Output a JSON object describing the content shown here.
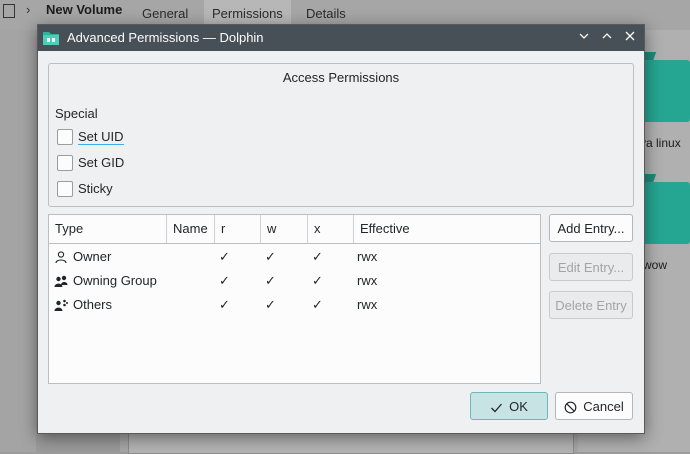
{
  "background": {
    "window_title": "New Volume",
    "tabs": [
      {
        "label": "General"
      },
      {
        "label": "Permissions"
      },
      {
        "label": "Details"
      }
    ],
    "folder_labels": [
      "va linux",
      "wow"
    ]
  },
  "dialog": {
    "title": "Advanced Permissions — Dolphin",
    "access_permissions": {
      "title": "Access Permissions",
      "special_label": "Special",
      "options": [
        {
          "label": "Set UID",
          "checked": false
        },
        {
          "label": "Set GID",
          "checked": false
        },
        {
          "label": "Sticky",
          "checked": false
        }
      ]
    },
    "table": {
      "columns": [
        "Type",
        "Name",
        "r",
        "w",
        "x",
        "Effective"
      ],
      "rows": [
        {
          "icon": "user-icon",
          "type": "Owner",
          "name": "",
          "r": "✓",
          "w": "✓",
          "x": "✓",
          "effective": "rwx"
        },
        {
          "icon": "group-icon",
          "type": "Owning Group",
          "name": "",
          "r": "✓",
          "w": "✓",
          "x": "✓",
          "effective": "rwx"
        },
        {
          "icon": "others-icon",
          "type": "Others",
          "name": "",
          "r": "✓",
          "w": "✓",
          "x": "✓",
          "effective": "rwx"
        }
      ]
    },
    "buttons": {
      "add_entry": "Add Entry...",
      "edit_entry": "Edit Entry...",
      "delete_entry": "Delete Entry",
      "ok": "OK",
      "cancel": "Cancel"
    }
  },
  "colors": {
    "titlebar": "#475057",
    "accent": "#3daee9",
    "ok_button_bg": "#c8e3e4",
    "folder": "#25a693"
  }
}
